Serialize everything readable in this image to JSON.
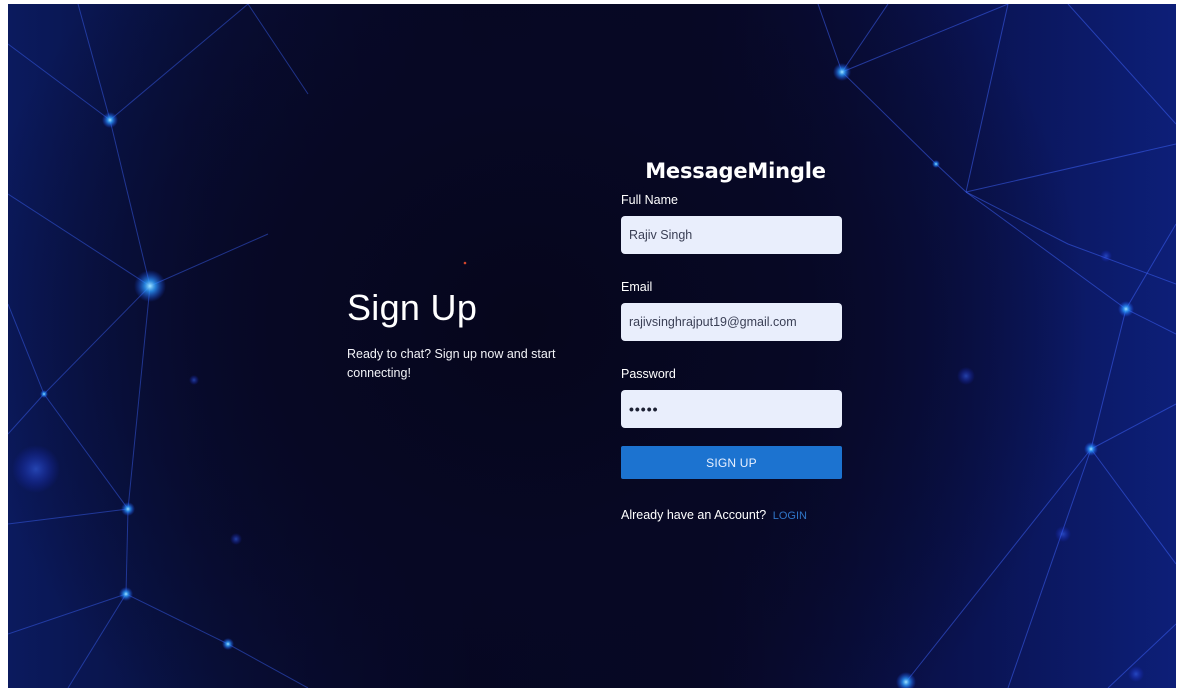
{
  "intro": {
    "title": "Sign Up",
    "tagline": "Ready to chat? Sign up now and start connecting!"
  },
  "form": {
    "brand": "MessageMingle",
    "full_name_label": "Full Name",
    "full_name_value": "Rajiv Singh",
    "email_label": "Email",
    "email_value": "rajivsinghrajput19@gmail.com",
    "password_label": "Password",
    "password_value": "•••••",
    "submit_label": "SIGN UP",
    "account_prompt": "Already have an Account?",
    "login_link": "LOGIN"
  },
  "colors": {
    "button": "#1c73d0",
    "field_bg": "#e9eefc",
    "link": "#2f75c7",
    "background_dark": "#060620",
    "background_edge": "#0d1f78"
  }
}
